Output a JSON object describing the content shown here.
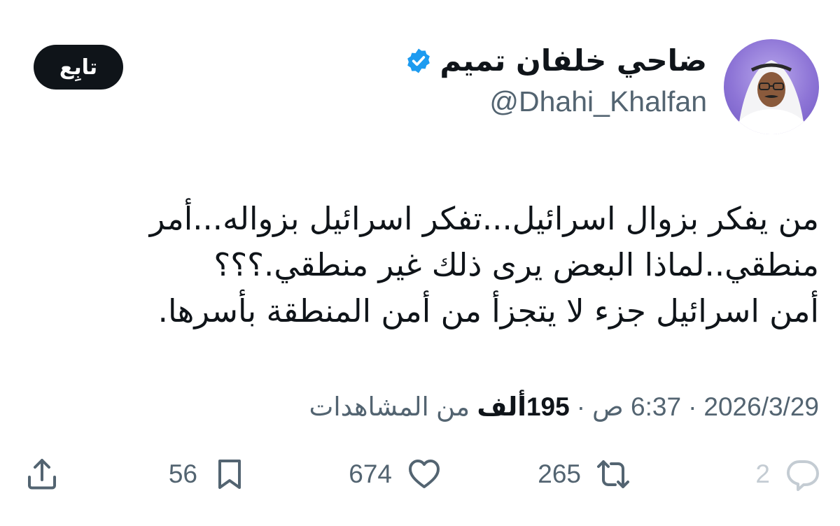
{
  "author": {
    "display_name": "ضاحي خلفان تميم",
    "handle": "@Dhahi_Khalfan",
    "verified": true
  },
  "follow_button": {
    "label": "تابِع"
  },
  "tweet": {
    "text": "من يفكر بزوال اسرائيل...تفكر اسرائيل بزواله...أمر منطقي..لماذا البعض يرى ذلك غير منطقي.؟؟؟\nأمن اسرائيل جزء لا يتجزأ من أمن المنطقة بأسرها."
  },
  "meta": {
    "date": "2026/3/29",
    "separator": "·",
    "time": "6:37 ص",
    "views_count": "195",
    "views_unit": "ألف",
    "views_label": "من المشاهدات"
  },
  "actions": {
    "reply": {
      "icon": "reply-icon",
      "count": "2"
    },
    "retweet": {
      "icon": "retweet-icon",
      "count": "265"
    },
    "like": {
      "icon": "heart-icon",
      "count": "674"
    },
    "bookmark": {
      "icon": "bookmark-icon",
      "count": "56"
    },
    "share": {
      "icon": "share-icon"
    }
  },
  "colors": {
    "text": "#0f1419",
    "secondary": "#536471",
    "verified": "#1d9bf0",
    "follow_bg": "#0f1419"
  }
}
